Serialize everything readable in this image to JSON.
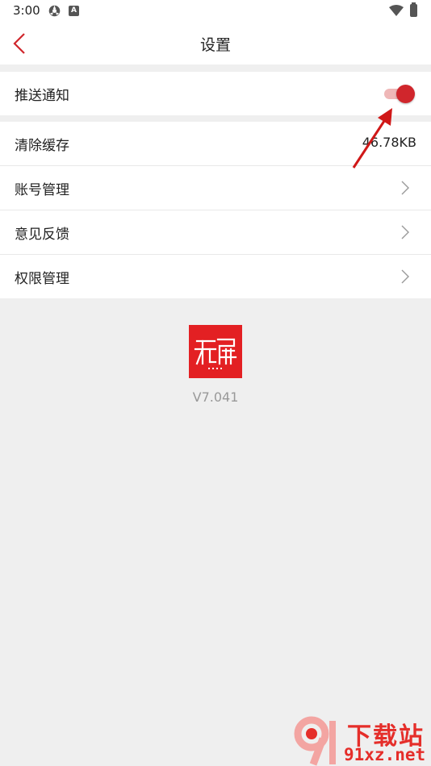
{
  "status_bar": {
    "time": "3:00",
    "icon_a": "settings-sync-icon",
    "icon_b_letter": "A",
    "wifi_icon": "wifi-icon",
    "battery_icon": "battery-icon"
  },
  "header": {
    "back_icon": "back-chevron-icon",
    "title": "设置"
  },
  "push": {
    "label": "推送通知",
    "enabled": true
  },
  "settings": {
    "cache_label": "清除缓存",
    "cache_value": "46.78KB",
    "account_label": "账号管理",
    "feedback_label": "意见反馈",
    "permissions_label": "权限管理"
  },
  "app": {
    "logo_icon": "app-logo",
    "version": "V7.041"
  },
  "watermark": {
    "logo_icon": "91xz-logo",
    "cn": "下载站",
    "en": "91xz.net"
  },
  "colors": {
    "accent": "#d0262c",
    "toggle_track": "#efb7b7",
    "logo_bg": "#e32023",
    "background": "#efefef"
  }
}
